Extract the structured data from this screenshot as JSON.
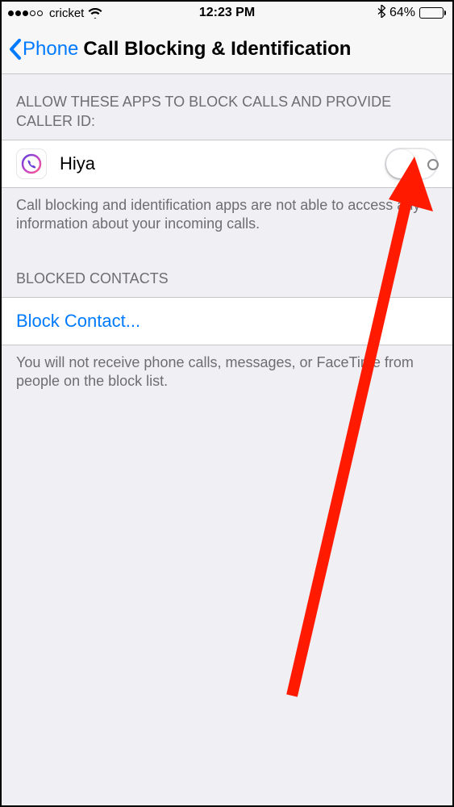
{
  "status_bar": {
    "carrier": "cricket",
    "time": "12:23 PM",
    "battery_percent": "64%"
  },
  "nav": {
    "back_label": "Phone",
    "title": "Call Blocking & Identification"
  },
  "sections": {
    "allow_header": "ALLOW THESE APPS TO BLOCK CALLS AND PROVIDE CALLER ID:",
    "app_name": "Hiya",
    "allow_footer": "Call blocking and identification apps are not able to access any information about your incoming calls.",
    "blocked_header": "BLOCKED CONTACTS",
    "block_contact_label": "Block Contact...",
    "blocked_footer": "You will not receive phone calls, messages, or FaceTime from people on the block list."
  }
}
